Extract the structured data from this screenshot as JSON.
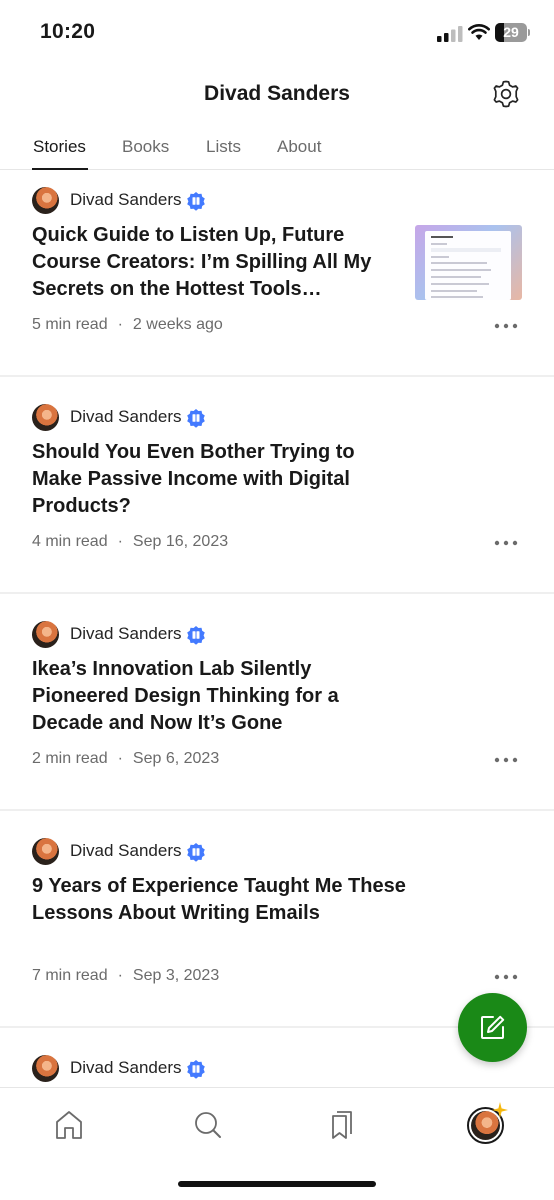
{
  "status_bar": {
    "time": "10:20",
    "battery": "29"
  },
  "header": {
    "title": "Divad Sanders"
  },
  "tabs": [
    {
      "label": "Stories",
      "active": true
    },
    {
      "label": "Books",
      "active": false
    },
    {
      "label": "Lists",
      "active": false
    },
    {
      "label": "About",
      "active": false
    }
  ],
  "stories": [
    {
      "author": "Divad Sanders",
      "title": "Quick Guide to Listen Up, Future Course Creators: I’m Spilling All My Secrets on the Hottest Tools…",
      "read_time": "5 min read",
      "date": "2 weeks ago",
      "has_thumbnail": true
    },
    {
      "author": "Divad Sanders",
      "title": "Should You Even Bother Trying to Make Passive Income with Digital Products?",
      "read_time": "4 min read",
      "date": "Sep 16, 2023",
      "has_thumbnail": false
    },
    {
      "author": "Divad Sanders",
      "title": "Ikea’s Innovation Lab Silently Pioneered Design Thinking for a Decade and Now It’s Gone",
      "read_time": "2 min read",
      "date": "Sep 6, 2023",
      "has_thumbnail": false
    },
    {
      "author": "Divad Sanders",
      "title": "9 Years of Experience Taught Me These Lessons About Writing Emails",
      "read_time": "7 min read",
      "date": "Sep 3, 2023",
      "has_thumbnail": false
    },
    {
      "author": "Divad Sanders",
      "title": "",
      "read_time": "",
      "date": "",
      "has_thumbnail": false
    }
  ],
  "meta_separator": "·",
  "icons": {
    "settings": "gear-icon",
    "verified": "verified-badge-icon",
    "more": "more-horizontal-icon",
    "compose": "compose-icon",
    "nav": [
      "home-icon",
      "search-icon",
      "bookmarks-icon",
      "profile-avatar"
    ]
  },
  "colors": {
    "accent_green": "#1a8917",
    "verified_blue": "#437aff",
    "text": "#191919",
    "muted": "#6b6b6b",
    "star": "#f5b80f"
  }
}
